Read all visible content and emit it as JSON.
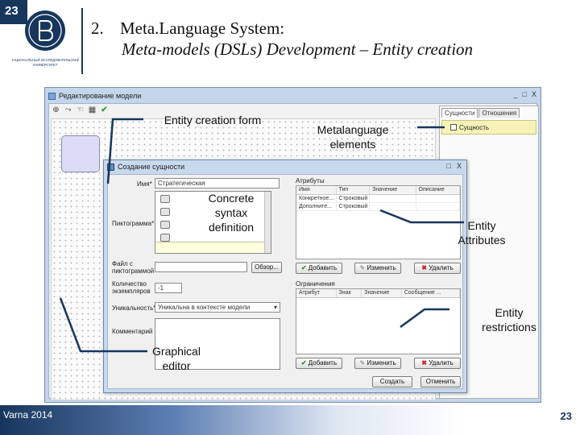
{
  "slide": {
    "number_corner": "23",
    "title_number": "2.",
    "title": "Meta.Language System:",
    "subtitle": "Meta-models (DSLs) Development – Entity creation",
    "footer_left": "Varna 2014",
    "footer_right": "23",
    "logo_caption": "НАЦИОНАЛЬНЫЙ ИССЛЕДОВАТЕЛЬСКИЙ УНИВЕРСИТЕТ"
  },
  "main_window": {
    "title": "Редактирование модели",
    "controls": [
      "_",
      "□",
      "X"
    ],
    "toolbar_icons": [
      "cursor-icon",
      "link-icon",
      "hand-icon",
      "grid-icon",
      "check-icon"
    ],
    "toolbar_glyphs": [
      "⊕",
      "⤳",
      "☜",
      "▦",
      "✔"
    ],
    "tabs": [
      "Сущности",
      "Отношения"
    ],
    "element_item": "Сущность"
  },
  "dialog": {
    "title": "Создание сущности",
    "controls": [
      "□",
      "X"
    ],
    "name_label": "Имя*",
    "name_value": "Стратегическая",
    "icon_label": "Пиктограмма*",
    "file_label": "Файл с пиктограммой",
    "browse_label": "Обзор...",
    "count_label": "Количество экземпляров",
    "count_value": "-1",
    "uniqueness_label": "Уникальность*",
    "uniqueness_value": "Уникальна в контексте модели",
    "comment_label": "Комментарий",
    "attributes": {
      "group": "Атрибуты",
      "columns": [
        "Имя",
        "Тип",
        "Значение",
        "Описание"
      ],
      "rows": [
        [
          "Конкретное...",
          "Строковый",
          "",
          ""
        ],
        [
          "Дополните...",
          "Строковый",
          "",
          ""
        ]
      ],
      "add": "Добавить",
      "edit": "Изменить",
      "remove": "Удалить"
    },
    "restrictions": {
      "group": "Ограничения",
      "columns": [
        "Атрибут",
        "Знак",
        "Значение",
        "Сообщение ..."
      ],
      "add": "Добавить",
      "edit": "Изменить",
      "remove": "Удалить"
    },
    "save": "Создать",
    "cancel": "Отменить"
  },
  "callouts": {
    "entity_form": "Entity creation form",
    "metalanguage": "Metalanguage elements",
    "concrete_syntax": "Concrete syntax definition",
    "attributes": "Entity Attributes",
    "restrictions": "Entity restrictions",
    "graphical_editor": "Graphical editor"
  }
}
